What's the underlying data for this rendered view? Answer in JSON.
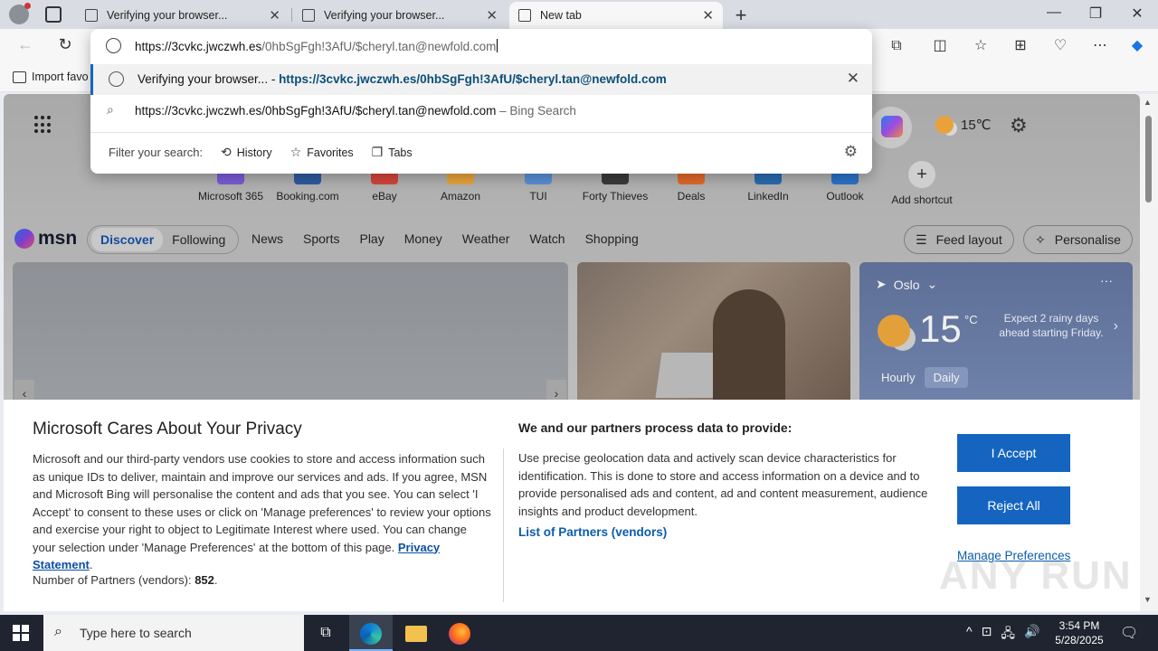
{
  "browser": {
    "tabs": [
      {
        "title": "Verifying your browser...",
        "active": false
      },
      {
        "title": "Verifying your browser...",
        "active": false
      },
      {
        "title": "New tab",
        "active": true
      }
    ],
    "new_tab_glyph": "+",
    "window_controls": {
      "minimize": "—",
      "maximize": "❐",
      "close": "✕"
    },
    "back_glyph": "←",
    "refresh_glyph": "↻",
    "toolbar_icons": [
      "extensions-icon",
      "split-screen-icon",
      "favorites-icon",
      "collections-icon",
      "performance-icon",
      "more-icon",
      "copilot-icon"
    ],
    "toolbar_glyphs": [
      "⧉",
      "◫",
      "☆",
      "⊞",
      "♡",
      "⋯",
      "◆"
    ],
    "favorites_bar": {
      "import_label": "Import favo"
    }
  },
  "omnibox": {
    "url_host": "https://3cvkc.jwczwh.es",
    "url_rest": "/0hbSgFgh!3AfU/$cheryl.tan@newfold.com",
    "suggestions": [
      {
        "prefix": "Verifying your browser... - ",
        "url": "https://3cvkc.jwczwh.es/0hbSgFgh!3AfU/$cheryl.tan@newfold.com",
        "close": "✕"
      },
      {
        "text": "https://3cvkc.jwczwh.es/0hbSgFgh!3AfU/$cheryl.tan@newfold.com",
        "suffix": " – Bing Search"
      }
    ],
    "filter_label": "Filter your search:",
    "filters": [
      {
        "label": "History",
        "icon": "history-icon",
        "glyph": "⟲"
      },
      {
        "label": "Favorites",
        "icon": "star-icon",
        "glyph": "☆"
      },
      {
        "label": "Tabs",
        "icon": "tabs-icon",
        "glyph": "❐"
      }
    ],
    "settings_glyph": "⚙"
  },
  "newtab": {
    "weather_top": "15℃",
    "gear_glyph": "⚙",
    "shortcuts": [
      {
        "label": "Microsoft 365",
        "color": "#7a5bd6"
      },
      {
        "label": "Booking.com",
        "color": "#2d5a9e"
      },
      {
        "label": "eBay",
        "color": "#d3453b"
      },
      {
        "label": "Amazon",
        "color": "#e8a33a"
      },
      {
        "label": "TUI",
        "color": "#5a8fd6"
      },
      {
        "label": "Forty Thieves",
        "color": "#3a3a3a"
      },
      {
        "label": "Deals",
        "color": "#e0692b"
      },
      {
        "label": "LinkedIn",
        "color": "#2a6bb0"
      },
      {
        "label": "Outlook",
        "color": "#2a73c8"
      }
    ],
    "add_shortcut": {
      "label": "Add shortcut",
      "glyph": "+"
    }
  },
  "msn": {
    "logo_text": "msn",
    "segments": [
      "Discover",
      "Following"
    ],
    "nav": [
      "News",
      "Sports",
      "Play",
      "Money",
      "Weather",
      "Watch",
      "Shopping"
    ],
    "feed_layout": "Feed layout",
    "personalise": "Personalise",
    "weather_card": {
      "location": "Oslo",
      "temp": "15",
      "unit": "°C",
      "forecast": "Expect 2 rainy days ahead starting Friday.",
      "hourly": "Hourly",
      "daily": "Daily",
      "more": "···"
    }
  },
  "privacy": {
    "title": "Microsoft Cares About Your Privacy",
    "body": "Microsoft and our third-party vendors use cookies to store and access information such as unique IDs to deliver, maintain and improve our services and ads. If you agree, MSN and Microsoft Bing will personalise the content and ads that you see. You can select 'I Accept' to consent to these uses or click on 'Manage preferences' to review your options and exercise your right to object to Legitimate Interest where used.  You can change your selection under 'Manage Preferences' at the bottom of this page.",
    "privacy_link": "Privacy Statement",
    "partners_label": "Number of Partners (vendors):",
    "partners_count": "852",
    "subtitle": "We and our partners process data to provide:",
    "description": "Use precise geolocation data and actively scan device characteristics for identification. This is done to store and access information on a device and to provide personalised ads and content, ad and content measurement, audience insights and product development.",
    "partners_link": "List of Partners (vendors)",
    "accept": "I Accept",
    "reject": "Reject All",
    "manage": "Manage Preferences",
    "watermark": "ANY RUN"
  },
  "taskbar": {
    "search_placeholder": "Type here to search",
    "time": "3:54 PM",
    "date": "5/28/2025",
    "tray_glyphs": [
      "^",
      "⊡",
      "🖧",
      "🔊"
    ]
  }
}
